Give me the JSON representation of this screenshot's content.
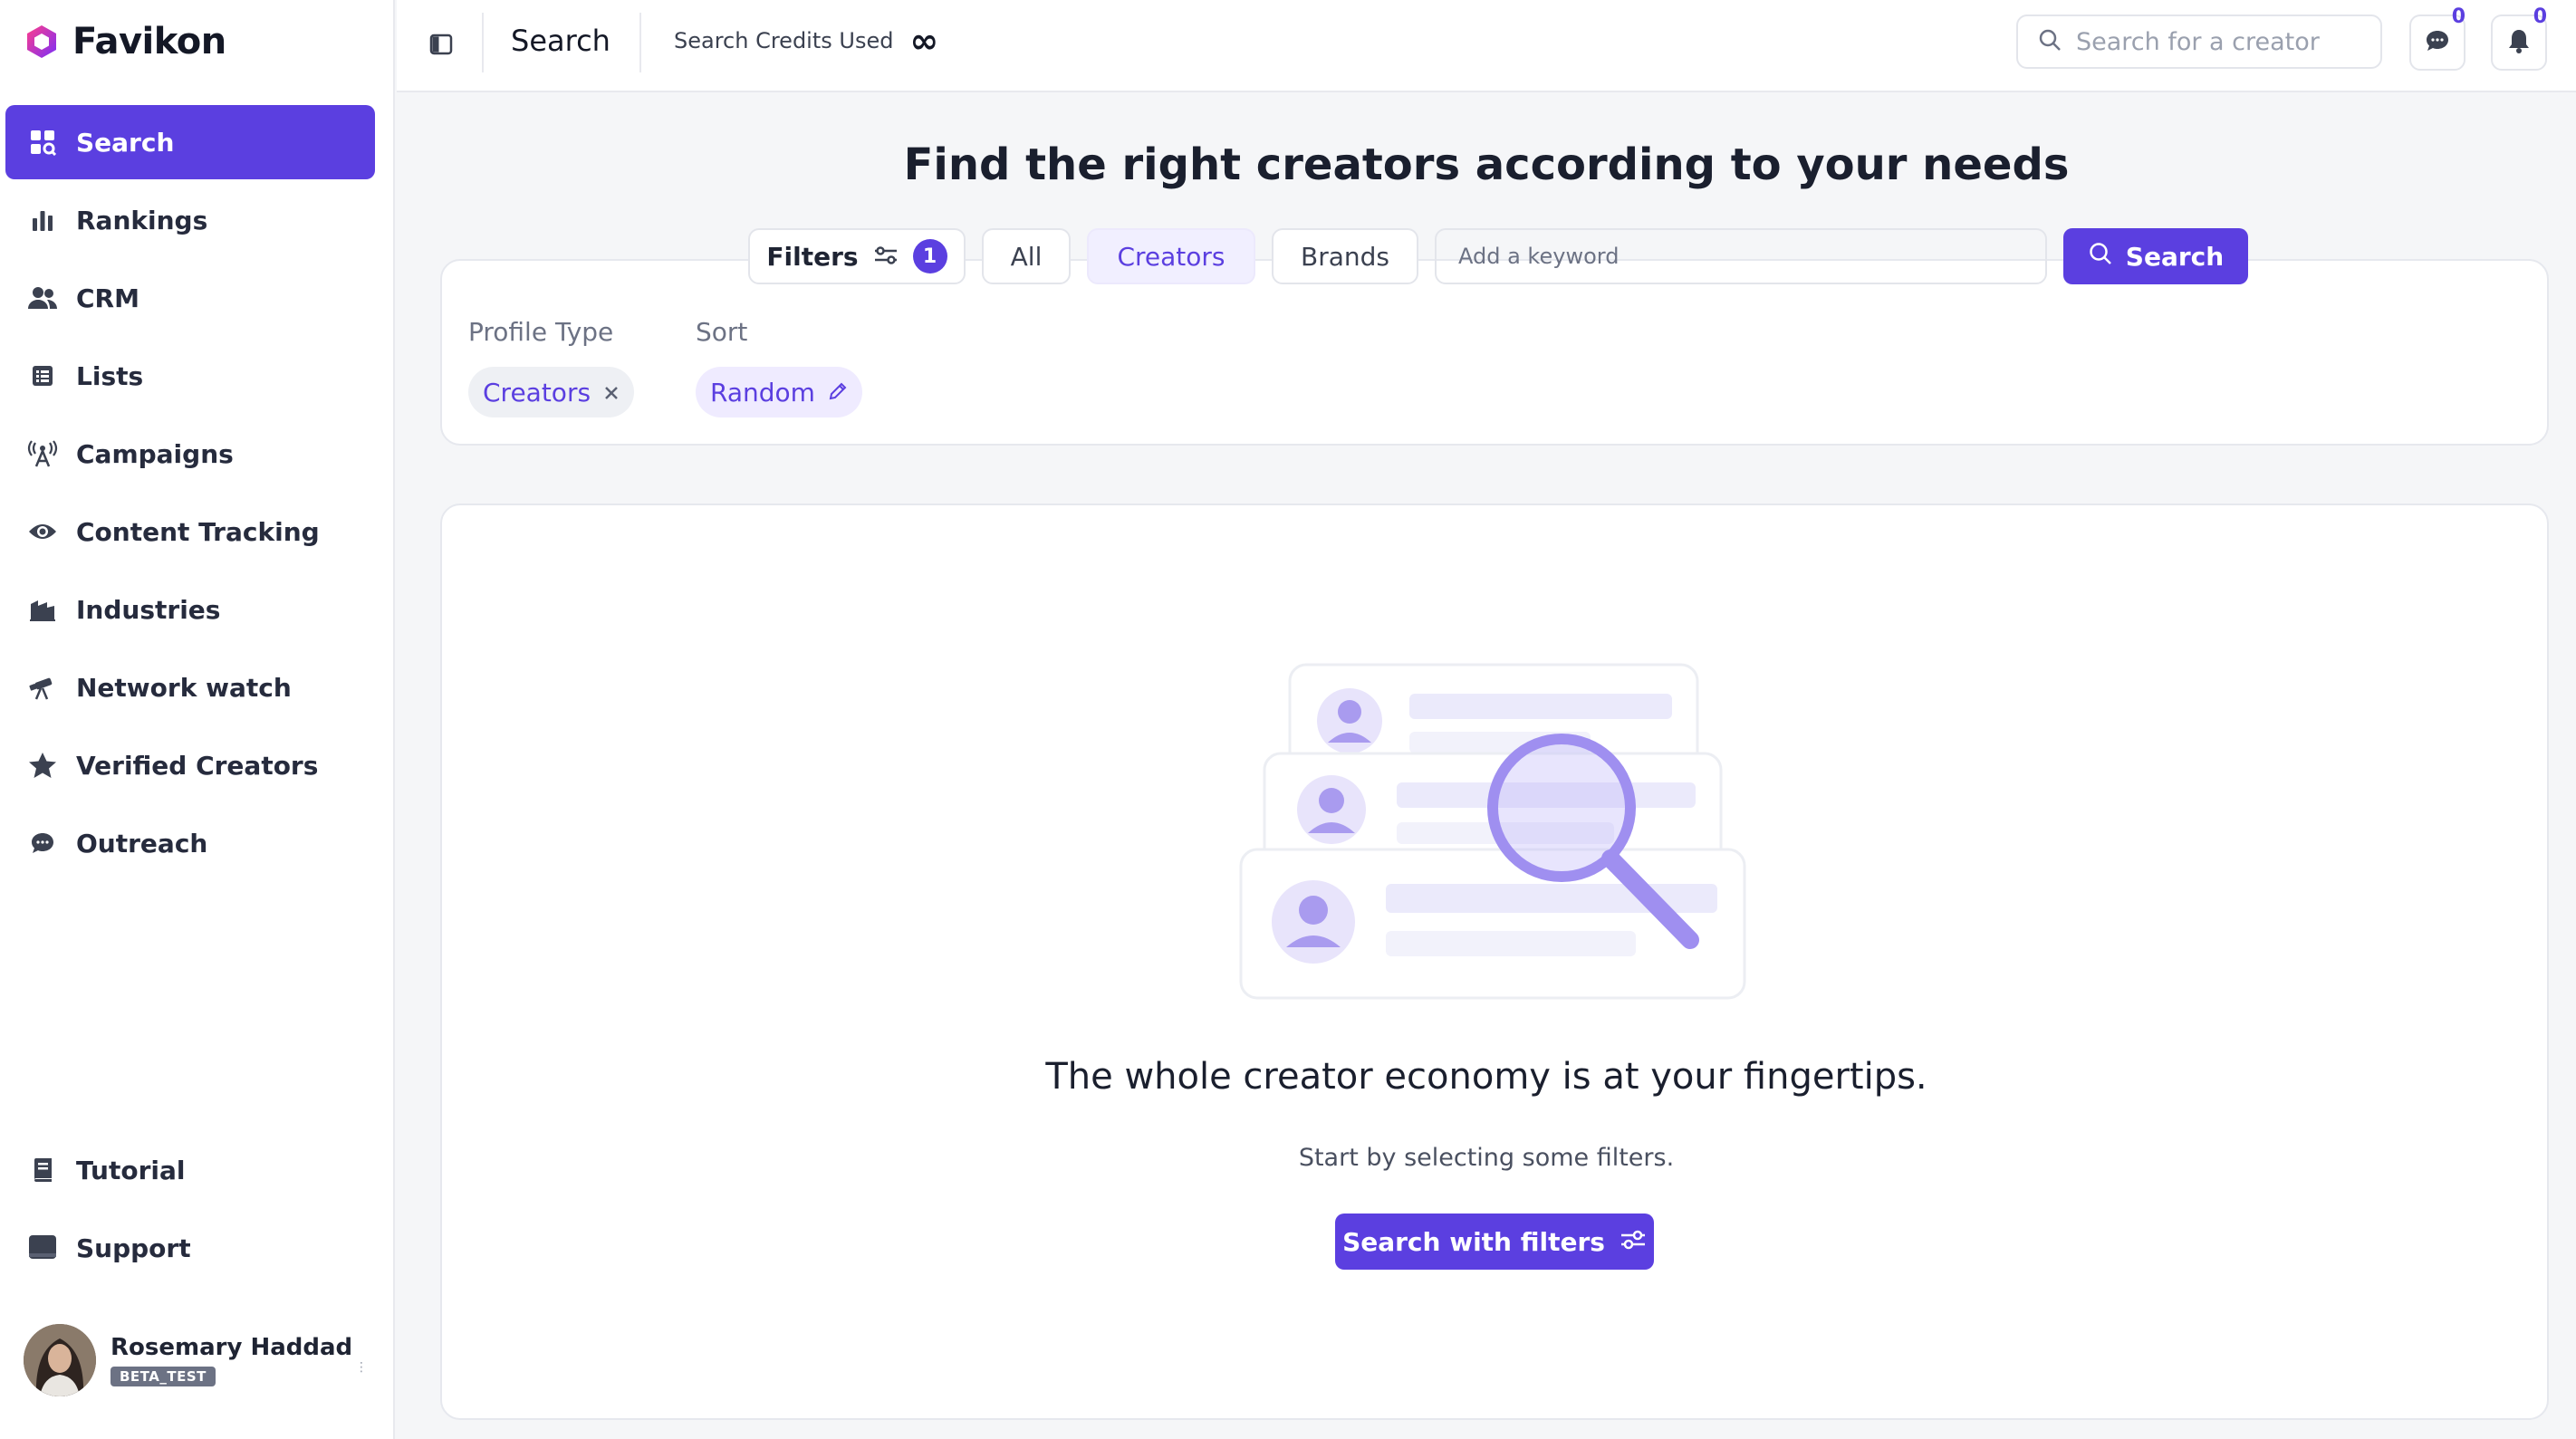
{
  "app": {
    "name": "Favikon",
    "accent": "#5b3fe0"
  },
  "sidebar": {
    "items": [
      {
        "label": "Search",
        "icon": "search-grid-icon",
        "active": true
      },
      {
        "label": "Rankings",
        "icon": "bar-chart-icon"
      },
      {
        "label": "CRM",
        "icon": "users-icon"
      },
      {
        "label": "Lists",
        "icon": "list-icon"
      },
      {
        "label": "Campaigns",
        "icon": "broadcast-icon"
      },
      {
        "label": "Content Tracking",
        "icon": "eye-icon"
      },
      {
        "label": "Industries",
        "icon": "industry-icon"
      },
      {
        "label": "Network watch",
        "icon": "telescope-icon"
      },
      {
        "label": "Verified Creators",
        "icon": "star-icon"
      },
      {
        "label": "Outreach",
        "icon": "chat-icon"
      }
    ],
    "bottom_items": [
      {
        "label": "Tutorial",
        "icon": "book-icon"
      },
      {
        "label": "Support",
        "icon": "inbox-icon"
      }
    ],
    "user": {
      "name": "Rosemary Haddad",
      "badge": "BETA_TEST"
    }
  },
  "topbar": {
    "title": "Search",
    "credits_label": "Search Credits Used",
    "credits_value": "∞",
    "creator_search_placeholder": "Search for a creator",
    "messages_count": "0",
    "notifications_count": "0"
  },
  "main": {
    "headline": "Find the right creators according to your needs",
    "filters_label": "Filters",
    "filters_count": "1",
    "tabs": [
      "All",
      "Creators",
      "Brands"
    ],
    "active_tab": "Creators",
    "keyword_placeholder": "Add a keyword",
    "search_button": "Search",
    "filter_groups": [
      {
        "label": "Profile Type",
        "value": "Creators"
      },
      {
        "label": "Sort",
        "value": "Random"
      }
    ],
    "empty_title": "The whole creator economy is at your fingertips.",
    "empty_subtitle": "Start by selecting some filters.",
    "cta_label": "Search with filters"
  }
}
